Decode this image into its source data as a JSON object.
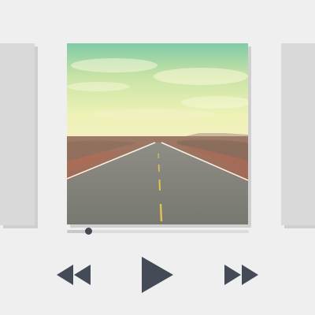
{
  "player": {
    "progress_fraction": 0.12,
    "icons": {
      "previous": "rewind-icon",
      "play": "play-icon",
      "next": "fast-forward-icon"
    },
    "colors": {
      "background": "#efefef",
      "side_card": "#d9d9d9",
      "control_icon": "#454a57",
      "progress_track": "#dcdcdc"
    }
  },
  "carousel": {
    "items": [
      {
        "artwork": "placeholder"
      },
      {
        "artwork": "desert-road-photo"
      },
      {
        "artwork": "placeholder"
      }
    ]
  }
}
